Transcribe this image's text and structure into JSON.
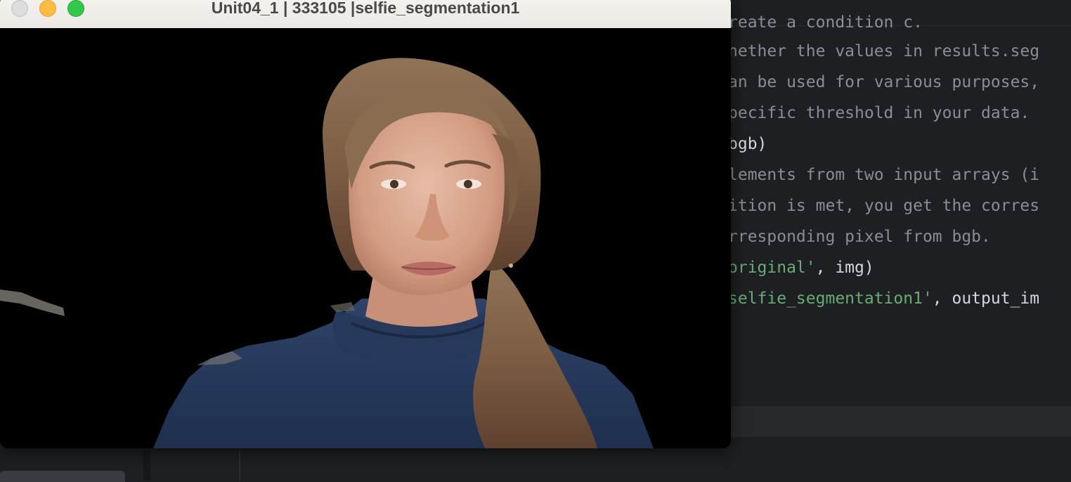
{
  "window": {
    "title": "Unit04_1 | 333105 |selfie_segmentation1",
    "buttons": {
      "close": "close-button",
      "minimize": "minimize-button",
      "zoom": "zoom-button"
    }
  },
  "editor": {
    "lines": [
      "reate a condition c.",
      "nether the values in results.seg",
      "an be used for various purposes,",
      "pecific threshold in your data.",
      "bgb)",
      "lements from two input arrays (i",
      "ition is met, you get the corres",
      "rresponding pixel from bgb."
    ],
    "imshow_original": {
      "str": "original'",
      "rest": ", img)"
    },
    "imshow_segmented": {
      "str": "selfie_segmentation1'",
      "rest": ", output_im"
    }
  },
  "colors": {
    "ide_background": "#1e1f22",
    "comment_text": "#8a8d93",
    "code_text": "#d4d6dc",
    "string_text": "#6aab73",
    "titlebar": "#ece8e5"
  },
  "icons": {
    "close": "traffic-light-red",
    "minimize": "traffic-light-yellow",
    "zoom": "traffic-light-green"
  }
}
